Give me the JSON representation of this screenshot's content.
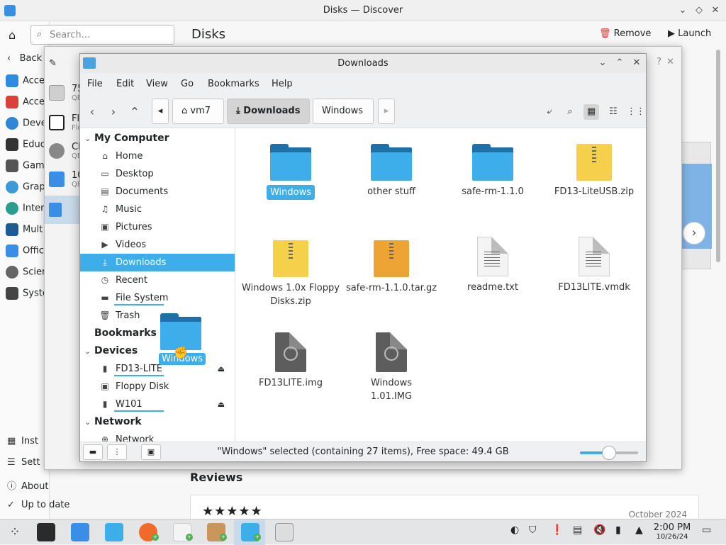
{
  "discover": {
    "title": "Disks — Discover",
    "search_placeholder": "Search...",
    "heading": "Disks",
    "remove_label": "Remove",
    "launch_label": "Launch",
    "back_label": "Back",
    "categories": [
      "Acce",
      "Acce",
      "Deve",
      "Educ",
      "Gam",
      "Grap",
      "Inter",
      "Mult",
      "Offic",
      "Scier",
      "Syste"
    ],
    "bottom_items": [
      "Inst",
      "Sett",
      "About",
      "Up to date"
    ],
    "reviews_heading": "Reviews",
    "review_stars": "★★★★★",
    "review_date": "October 2024"
  },
  "props": {
    "items": [
      {
        "label": "75",
        "sub": "QE"
      },
      {
        "label": "Flo",
        "sub": "Flo"
      },
      {
        "label": "CD",
        "sub": "QE"
      },
      {
        "label": "10",
        "sub": "QE"
      }
    ]
  },
  "dolphin": {
    "title": "Downloads",
    "menu": [
      "File",
      "Edit",
      "View",
      "Go",
      "Bookmarks",
      "Help"
    ],
    "breadcrumbs": [
      "vm7",
      "Downloads",
      "Windows"
    ],
    "places": {
      "my_computer": "My Computer",
      "items": [
        "Home",
        "Desktop",
        "Documents",
        "Music",
        "Pictures",
        "Videos",
        "Downloads",
        "Recent",
        "File System",
        "Trash"
      ],
      "bookmarks": "Bookmarks",
      "devices": "Devices",
      "device_items": [
        "FD13-LITE",
        "Floppy Disk",
        "W101"
      ],
      "network": "Network",
      "network_items": [
        "Network"
      ]
    },
    "files": [
      {
        "name": "Windows",
        "type": "folder"
      },
      {
        "name": "other stuff",
        "type": "folder"
      },
      {
        "name": "safe-rm-1.1.0",
        "type": "folder"
      },
      {
        "name": "FD13-LiteUSB.zip",
        "type": "zip"
      },
      {
        "name": "Windows 1.0x Floppy Disks.zip",
        "type": "zip"
      },
      {
        "name": "safe-rm-1.1.0.tar.gz",
        "type": "targz"
      },
      {
        "name": "readme.txt",
        "type": "text"
      },
      {
        "name": "FD13LITE.vmdk",
        "type": "text"
      },
      {
        "name": "FD13LITE.img",
        "type": "img"
      },
      {
        "name": "Windows 1.01.IMG",
        "type": "img"
      }
    ],
    "status_text": "\"Windows\" selected (containing 27 items), Free space: 49.4 GB",
    "zoom_fraction": 0.5,
    "drag_label": "Windows"
  },
  "taskbar": {
    "time": "2:00 PM",
    "date": "10/26/24"
  },
  "colors": {
    "accent": "#3daee9",
    "folder_dark": "#1f6fa9",
    "zip_yellow": "#f5d04a",
    "targz_orange": "#eea434"
  }
}
